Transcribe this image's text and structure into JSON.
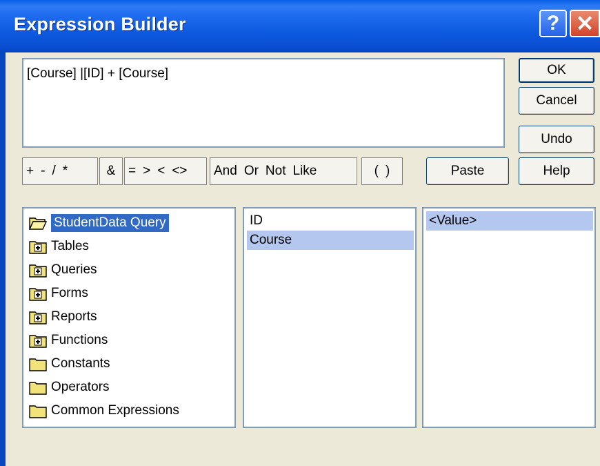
{
  "window": {
    "title": "Expression Builder"
  },
  "titlebar": {
    "help_glyph": "?",
    "close_glyph": "✕"
  },
  "expression": {
    "value": "[Course] |[ID] + [Course]"
  },
  "buttons": {
    "ok": "OK",
    "cancel": "Cancel",
    "undo": "Undo",
    "paste": "Paste",
    "help": "Help"
  },
  "operators": {
    "group1": [
      "+",
      "-",
      "/",
      "*"
    ],
    "group2": [
      "&"
    ],
    "group3": [
      "=",
      ">",
      "<",
      "<>"
    ],
    "group4": [
      "And",
      "Or",
      "Not",
      "Like"
    ],
    "group5": [
      "(",
      ")"
    ]
  },
  "tree": {
    "root": "StudentData Query",
    "items": [
      {
        "label": "Tables",
        "icon": "folder-plus-icon"
      },
      {
        "label": "Queries",
        "icon": "folder-plus-icon"
      },
      {
        "label": "Forms",
        "icon": "folder-plus-icon"
      },
      {
        "label": "Reports",
        "icon": "folder-plus-icon"
      },
      {
        "label": "Functions",
        "icon": "folder-plus-icon"
      },
      {
        "label": "Constants",
        "icon": "folder-icon"
      },
      {
        "label": "Operators",
        "icon": "folder-icon"
      },
      {
        "label": "Common Expressions",
        "icon": "folder-icon"
      }
    ]
  },
  "fields": {
    "items": [
      "ID",
      "Course"
    ],
    "selected": "Course"
  },
  "values": {
    "items": [
      "<Value>"
    ],
    "selected": "<Value>"
  },
  "colors": {
    "titlebar": "#0A50D4",
    "selection": "#316AC5",
    "light_selection": "#B4C7EE",
    "face": "#ECE9D8"
  }
}
